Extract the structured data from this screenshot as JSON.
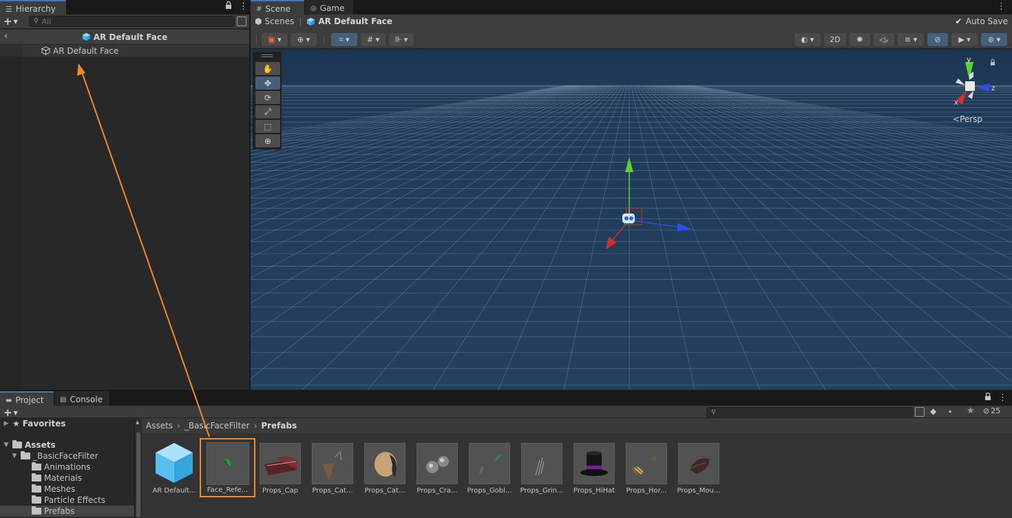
{
  "hierarchy": {
    "tab_label": "Hierarchy",
    "search_placeholder": "All",
    "header_title": "AR Default Face",
    "items": [
      {
        "label": "AR Default Face"
      }
    ]
  },
  "scene": {
    "tabs": [
      {
        "label": "Scene"
      },
      {
        "label": "Game"
      }
    ],
    "breadcrumb_root": "Scenes",
    "breadcrumb_current": "AR Default Face",
    "auto_save_label": "Auto Save",
    "auto_save_checked": true,
    "mode_2d_label": "2D",
    "gizmo_labels": {
      "y": "y",
      "x": "x",
      "z": "z"
    },
    "persp_label": "Persp",
    "viewport_color": "#1f3a57",
    "gizmo_colors": {
      "x": "#d42a2a",
      "y": "#5bd12e",
      "z": "#2f4cf0"
    }
  },
  "project": {
    "tabs": [
      {
        "label": "Project"
      },
      {
        "label": "Console"
      }
    ],
    "hidden_count": "25",
    "tree": {
      "favorites": "Favorites",
      "assets": "Assets",
      "basic_face_filter": "_BasicFaceFilter",
      "children": [
        "Animations",
        "Materials",
        "Meshes",
        "Particle Effects",
        "Prefabs"
      ]
    },
    "breadcrumb": [
      "Assets",
      "_BasicFaceFilter",
      "Prefabs"
    ],
    "assets": [
      {
        "label": "AR Default...",
        "icon": "cube-icon"
      },
      {
        "label": "Face_Refe...",
        "icon": "leaf-icon",
        "selected": true
      },
      {
        "label": "Props_Cap",
        "icon": "cap-icon"
      },
      {
        "label": "Props_Cat...",
        "icon": "cat-ear-icon"
      },
      {
        "label": "Props_Cat...",
        "icon": "cat-nose-icon"
      },
      {
        "label": "Props_Cra...",
        "icon": "spheres-icon"
      },
      {
        "label": "Props_Gobl...",
        "icon": "goblin-ears-icon"
      },
      {
        "label": "Props_Grin...",
        "icon": "whiskers-icon"
      },
      {
        "label": "Props_HiHat",
        "icon": "top-hat-icon"
      },
      {
        "label": "Props_Hor...",
        "icon": "horns-icon"
      },
      {
        "label": "Props_Mou...",
        "icon": "mouth-icon"
      }
    ],
    "accent_color": "#f28a2e"
  }
}
